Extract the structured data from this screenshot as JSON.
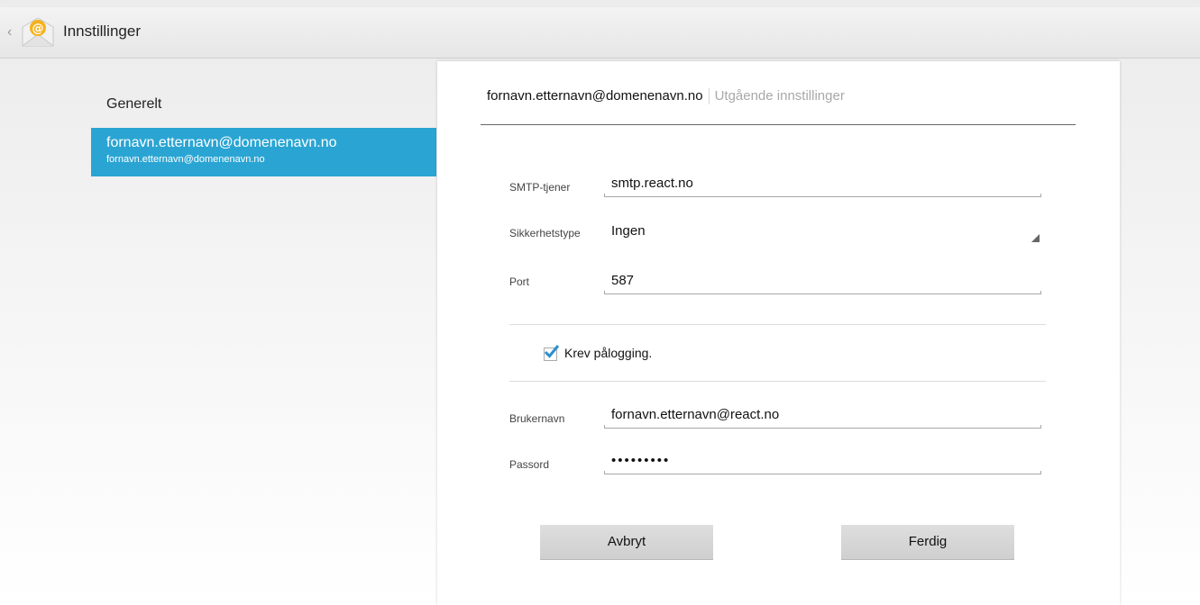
{
  "app": {
    "title": "Innstillinger",
    "icon": "email-app-icon"
  },
  "sidebar": {
    "general_label": "Generelt",
    "account": {
      "name": "fornavn.etternavn@domenenavn.no",
      "email": "fornavn.etternavn@domenenavn.no"
    }
  },
  "panel": {
    "breadcrumb": {
      "account": "fornavn.etternavn@domenenavn.no",
      "section": "Utgående innstillinger"
    },
    "smtp": {
      "label": "SMTP-tjener",
      "value": "smtp.react.no"
    },
    "security": {
      "label": "Sikkerhetstype",
      "value": "Ingen"
    },
    "port": {
      "label": "Port",
      "value": "587"
    },
    "require_login": {
      "label": "Krev pålogging.",
      "checked": true
    },
    "username": {
      "label": "Brukernavn",
      "value": "fornavn.etternavn@react.no"
    },
    "password": {
      "label": "Passord",
      "value": "•••••••••"
    },
    "buttons": {
      "cancel": "Avbryt",
      "done": "Ferdig"
    }
  },
  "colors": {
    "accent": "#2aa5d3",
    "checkbox": "#2a8fd0"
  }
}
